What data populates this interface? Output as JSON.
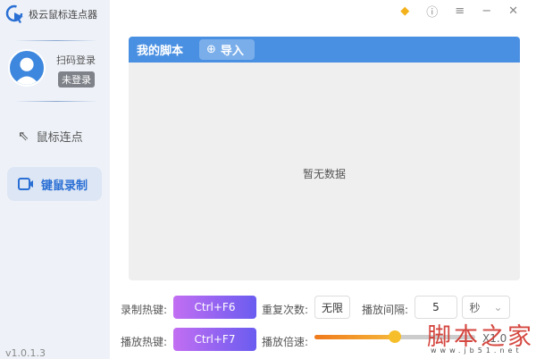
{
  "app": {
    "title": "极云鼠标连点器",
    "version": "v1.0.1.3"
  },
  "user": {
    "login_label": "扫码登录",
    "status": "未登录"
  },
  "nav": [
    {
      "label": "鼠标连点"
    },
    {
      "label": "键鼠录制"
    }
  ],
  "scripts": {
    "title": "我的脚本",
    "import_label": "导入",
    "empty_text": "暂无数据"
  },
  "controls": {
    "record_hotkey_label": "录制热键:",
    "record_hotkey": "Ctrl+F6",
    "play_hotkey_label": "播放热键:",
    "play_hotkey": "Ctrl+F7",
    "repeat_label": "重复次数:",
    "repeat_value": "无限",
    "interval_label": "播放间隔:",
    "interval_value": "5",
    "interval_unit": "秒",
    "speed_label": "播放倍速:",
    "speed_value": "X1.0",
    "speed_fraction": 0.5
  },
  "watermark": {
    "text": "脚本之家",
    "url": "www.jb51.net"
  },
  "colors": {
    "accent": "#4a90e2",
    "hotkey_start": "#c26ef2",
    "hotkey_end": "#6a5cf0"
  }
}
